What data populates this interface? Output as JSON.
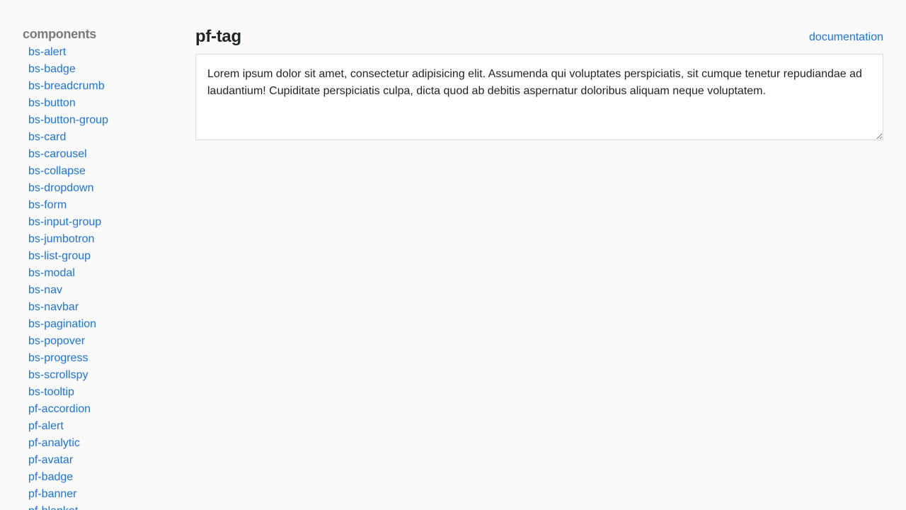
{
  "sidebar": {
    "heading": "components",
    "items": [
      {
        "label": "bs-alert"
      },
      {
        "label": "bs-badge"
      },
      {
        "label": "bs-breadcrumb"
      },
      {
        "label": "bs-button"
      },
      {
        "label": "bs-button-group"
      },
      {
        "label": "bs-card"
      },
      {
        "label": "bs-carousel"
      },
      {
        "label": "bs-collapse"
      },
      {
        "label": "bs-dropdown"
      },
      {
        "label": "bs-form"
      },
      {
        "label": "bs-input-group"
      },
      {
        "label": "bs-jumbotron"
      },
      {
        "label": "bs-list-group"
      },
      {
        "label": "bs-modal"
      },
      {
        "label": "bs-nav"
      },
      {
        "label": "bs-navbar"
      },
      {
        "label": "bs-pagination"
      },
      {
        "label": "bs-popover"
      },
      {
        "label": "bs-progress"
      },
      {
        "label": "bs-scrollspy"
      },
      {
        "label": "bs-tooltip"
      },
      {
        "label": "pf-accordion"
      },
      {
        "label": "pf-alert"
      },
      {
        "label": "pf-analytic"
      },
      {
        "label": "pf-avatar"
      },
      {
        "label": "pf-badge"
      },
      {
        "label": "pf-banner"
      },
      {
        "label": "pf-blanket"
      }
    ]
  },
  "main": {
    "title": "pf-tag",
    "documentation_link": "documentation",
    "textarea_value": "Lorem ipsum dolor sit amet, consectetur adipisicing elit. Assumenda qui voluptates perspiciatis, sit cumque tenetur repudiandae ad laudantium! Cupiditate perspiciatis culpa, dicta quod ab debitis aspernatur doloribus aliquam neque voluptatem."
  },
  "colors": {
    "link": "#1a73e8",
    "heading_muted": "#7a7a7a",
    "background": "#fafafa"
  }
}
